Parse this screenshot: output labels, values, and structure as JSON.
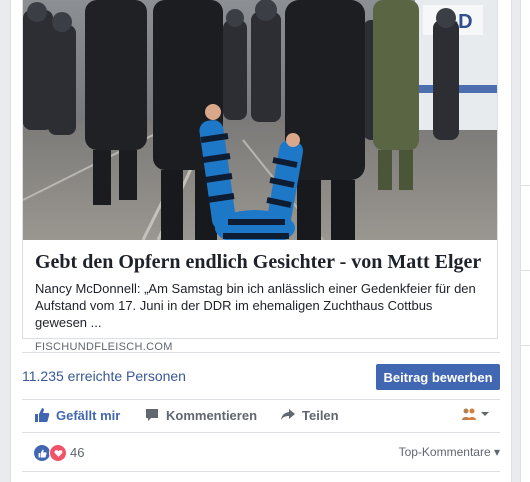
{
  "post": {
    "link": {
      "image": {
        "kind": "photo",
        "description_icon": "photo-icon",
        "sign_text": "H-D"
      },
      "title": "Gebt den Opfern endlich Gesichter - von Matt Elger",
      "description_line1": "Nancy McDonnell: „Am Samstag bin ich anlässlich einer Gedenkfeier für den",
      "description_line2": "Aufstand vom 17. Juni in der DDR im ehemaligen Zuchthaus Cottbus gewesen ...",
      "domain": "FISCHUNDFLEISCH.COM"
    },
    "reach": {
      "text": "11.235 erreichte Personen",
      "promote_label": "Beitrag bewerben"
    },
    "actions": {
      "like_label": "Gefällt mir",
      "comment_label": "Kommentieren",
      "share_label": "Teilen"
    },
    "reactions": {
      "count": "46",
      "top_comments_label": "Top-Kommentare"
    }
  },
  "colors": {
    "brand": "#4267b2",
    "link_text": "#385898",
    "love": "#f25268"
  }
}
